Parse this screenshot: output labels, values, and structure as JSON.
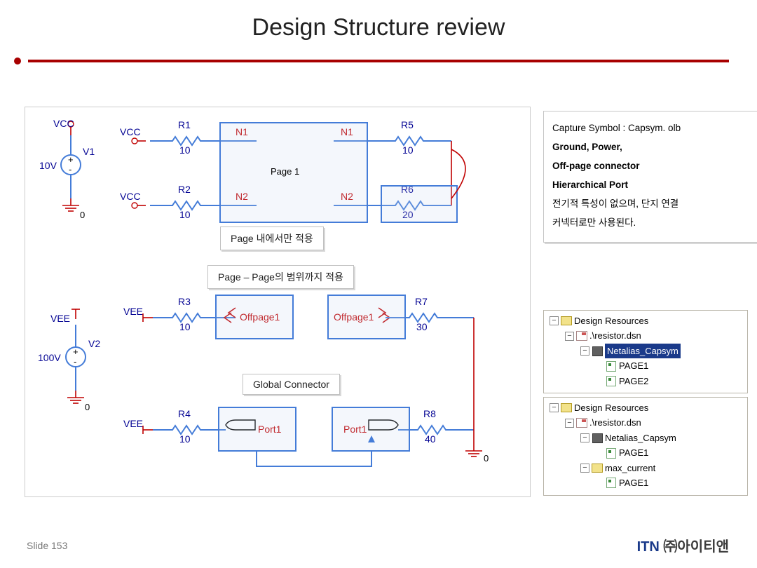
{
  "title": "Design Structure review",
  "diagram": {
    "vcc": "VCC",
    "vee": "VEE",
    "v1": "V1",
    "v2": "V2",
    "src1": "10V",
    "src2": "100V",
    "gnd0": "0",
    "page1_label": "Page 1",
    "rows": {
      "r1": {
        "ref": "R1",
        "val": "10",
        "net": "N1",
        "net2": "N1",
        "rref": "R5",
        "rval": "10"
      },
      "r2": {
        "ref": "R2",
        "val": "10",
        "net": "N2",
        "net2": "N2",
        "rref": "R6",
        "rval": "20"
      },
      "r3": {
        "ref": "R3",
        "val": "10",
        "net": "Offpage1",
        "net2": "Offpage1",
        "rref": "R7",
        "rval": "30"
      },
      "r4": {
        "ref": "R4",
        "val": "10",
        "net": "Port1",
        "net2": "Port1",
        "rref": "R8",
        "rval": "40"
      }
    },
    "callout_inpage": "Page 내에서만 적용",
    "callout_offpage": "Page – Page의 범위까지 적용",
    "callout_global": "Global Connector"
  },
  "infobox": {
    "line1a": "Capture Symbol : ",
    "line1b": "Capsym. olb",
    "line2": "Ground, Power,",
    "line3": "Off-page connector",
    "line4": "Hierarchical Port",
    "line5": "전기적 특성이 없으며, 단지 연결",
    "line6": "커넥터로만 사용된다."
  },
  "tree1": {
    "root": "Design Resources",
    "dsn": ".\\resistor.dsn",
    "sch": "Netalias_Capsym",
    "p1": "PAGE1",
    "p2": "PAGE2"
  },
  "tree2": {
    "root": "Design Resources",
    "dsn": ".\\resistor.dsn",
    "sch1": "Netalias_Capsym",
    "sch1p": "PAGE1",
    "sch2": "max_current",
    "sch2p": "PAGE1"
  },
  "footer": {
    "slide": "Slide 153",
    "brand1": "ITN",
    "brand2": "㈜아이티앤"
  }
}
